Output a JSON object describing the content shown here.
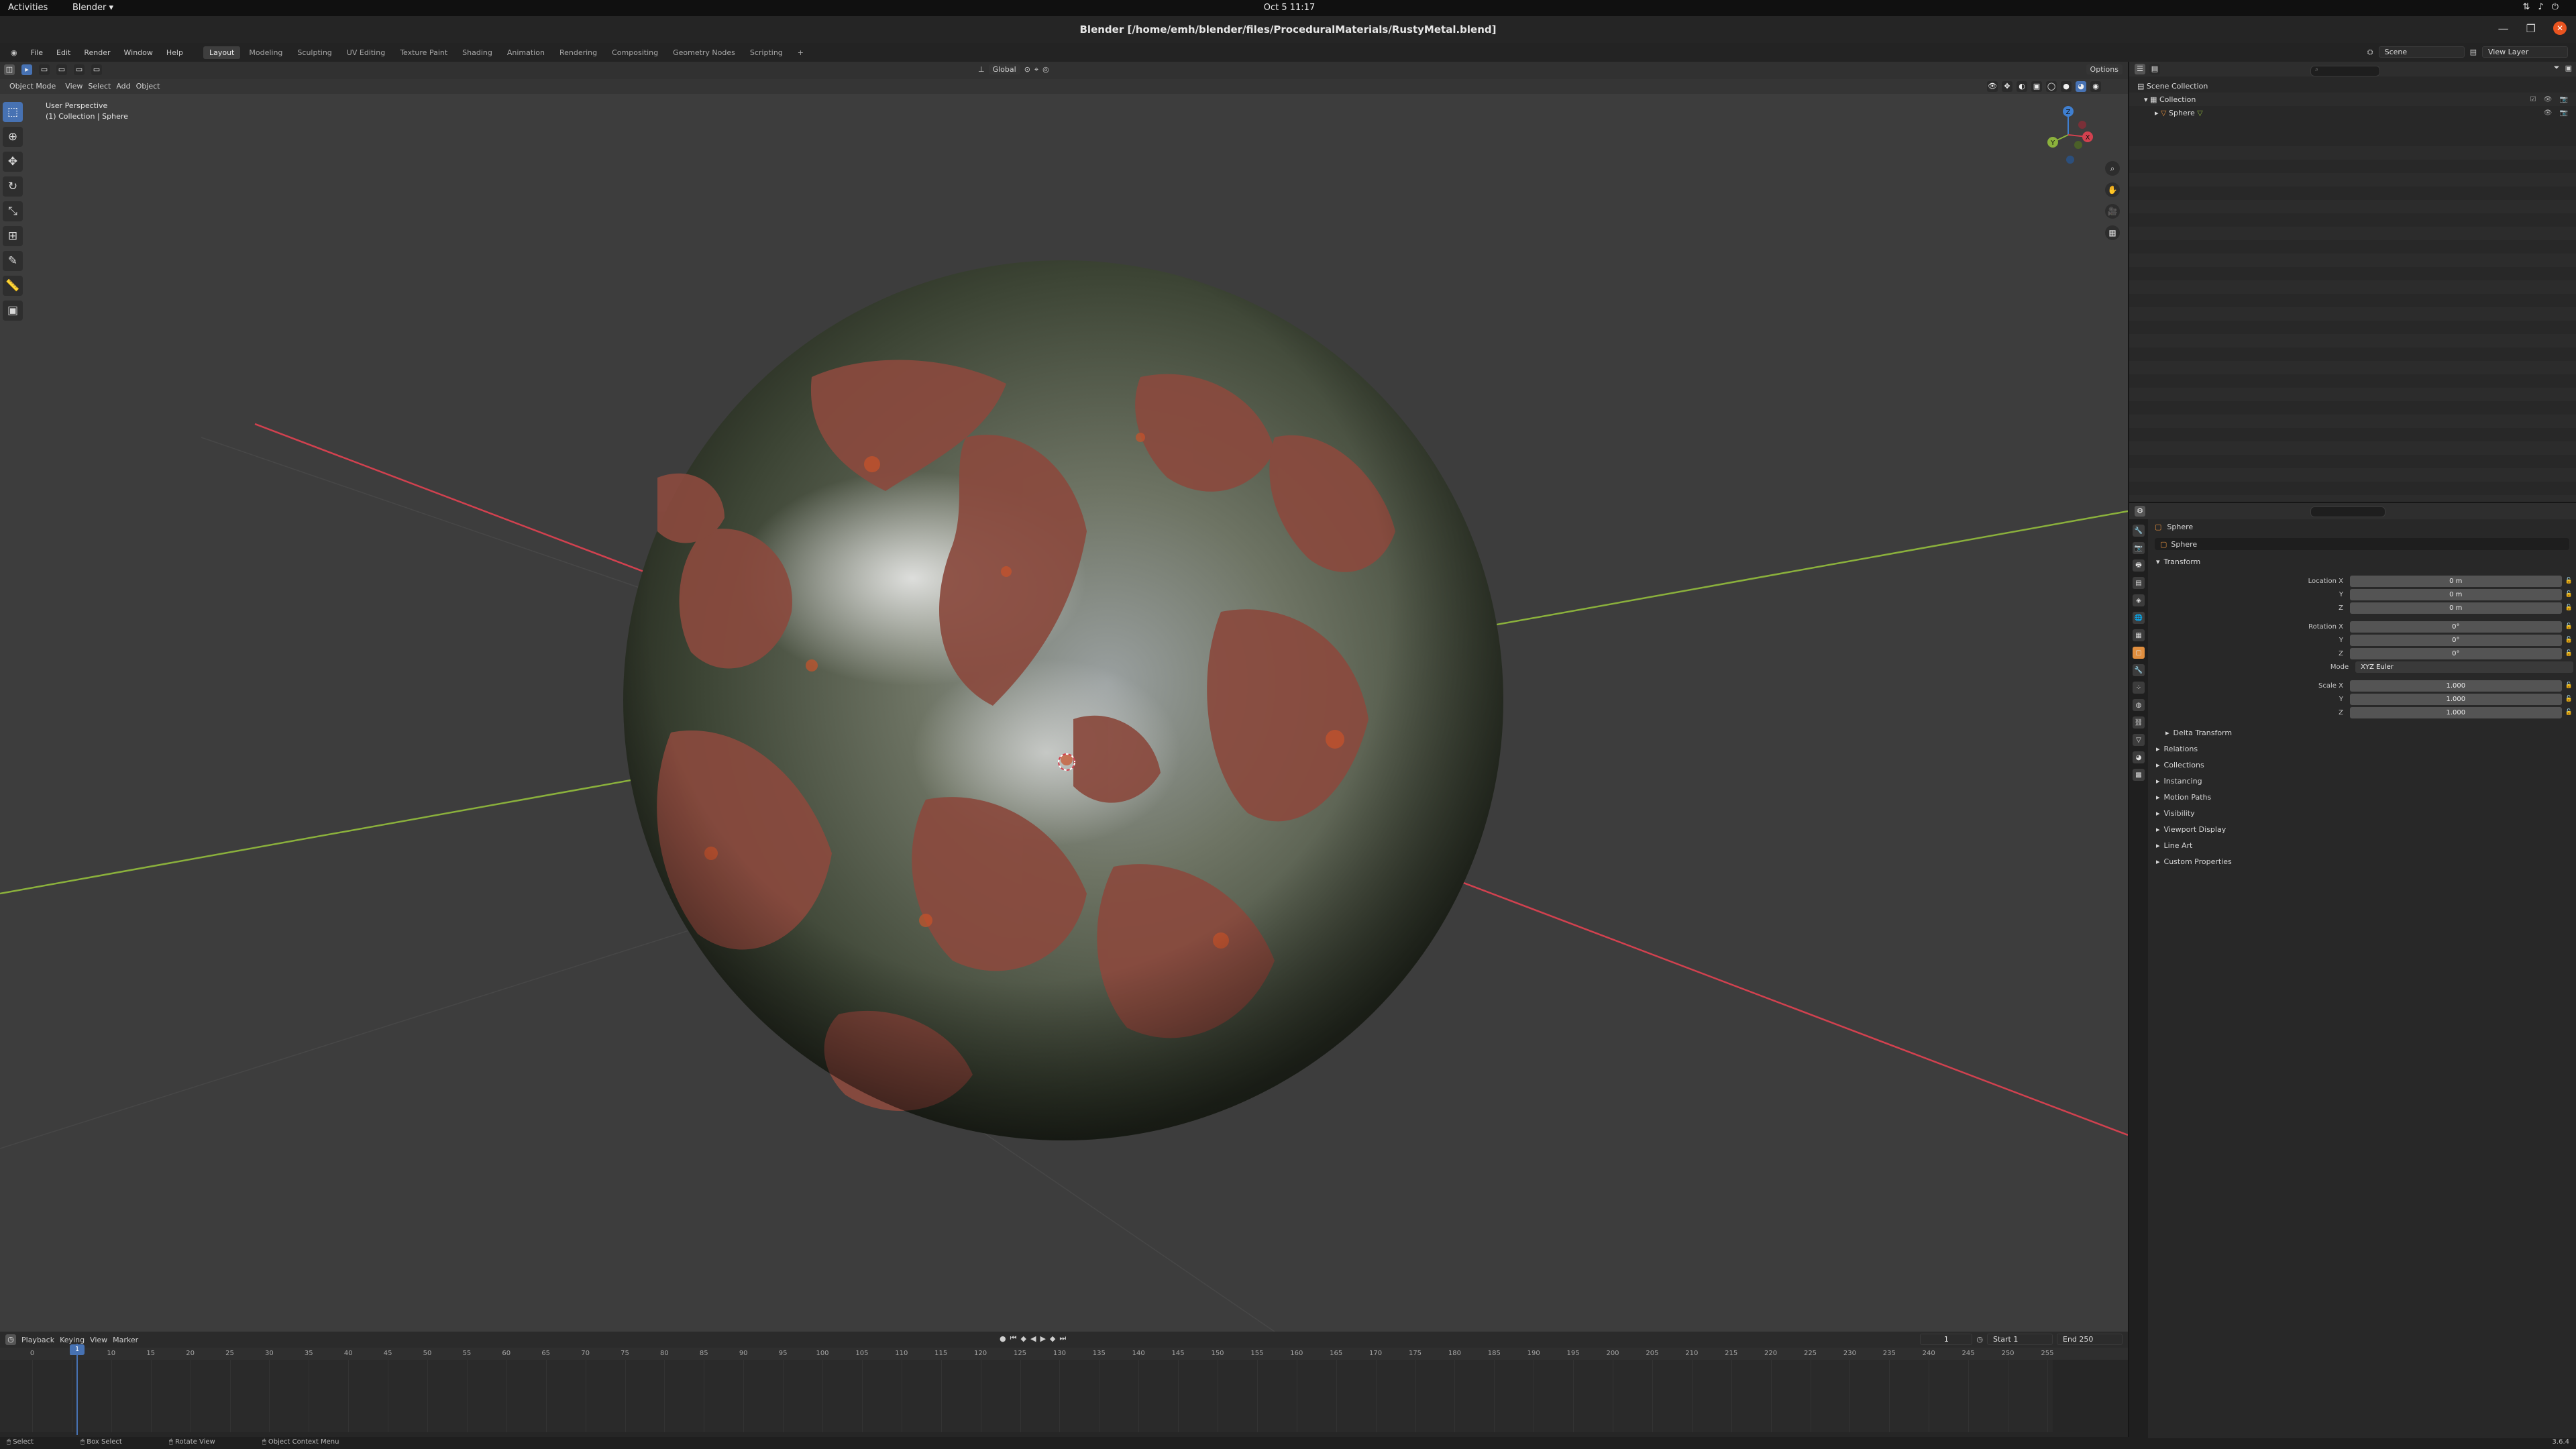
{
  "system_bar": {
    "activities": "Activities",
    "app": "Blender ▾",
    "clock": "Oct 5  11:17",
    "tray_icons": [
      "network-icon",
      "volume-icon",
      "power-icon"
    ]
  },
  "window": {
    "title": "Blender [/home/emh/blender/files/ProceduralMaterials/RustyMetal.blend]"
  },
  "menubar": {
    "menus": [
      "File",
      "Edit",
      "Render",
      "Window",
      "Help"
    ],
    "workspaces": [
      "Layout",
      "Modeling",
      "Sculpting",
      "UV Editing",
      "Texture Paint",
      "Shading",
      "Animation",
      "Rendering",
      "Compositing",
      "Geometry Nodes",
      "Scripting",
      "+"
    ],
    "active_workspace": "Layout",
    "scene": "Scene",
    "view_layer": "View Layer"
  },
  "viewport": {
    "mode": "Object Mode",
    "menus": [
      "View",
      "Select",
      "Add",
      "Object"
    ],
    "orientation": "Global",
    "options": "Options",
    "perspective": "User Perspective",
    "collection_info": "(1) Collection | Sphere",
    "tools": [
      "select-box-icon",
      "cursor-icon",
      "move-icon",
      "rotate-icon",
      "scale-icon",
      "transform-icon",
      "annotate-icon",
      "measure-icon",
      "add-cube-icon"
    ],
    "gizmo": {
      "x": "X",
      "y": "Y",
      "z": "Z"
    }
  },
  "timeline": {
    "menus": [
      "Playback",
      "Keying",
      "View",
      "Marker"
    ],
    "current_frame": "1",
    "start_label": "Start",
    "start": "1",
    "end_label": "End",
    "end": "250",
    "ruler": [
      "0",
      "5",
      "10",
      "15",
      "20",
      "25",
      "30",
      "35",
      "40",
      "45",
      "50",
      "55",
      "60",
      "65",
      "70",
      "75",
      "80",
      "85",
      "90",
      "95",
      "100",
      "105",
      "110",
      "115",
      "120",
      "125",
      "130",
      "135",
      "140",
      "145",
      "150",
      "155",
      "160",
      "165",
      "170",
      "175",
      "180",
      "185",
      "190",
      "195",
      "200",
      "205",
      "210",
      "215",
      "220",
      "225",
      "230",
      "235",
      "240",
      "245",
      "250",
      "255"
    ]
  },
  "statusbar": {
    "items": [
      "Select",
      "Box Select",
      "Rotate View",
      "Object Context Menu"
    ],
    "version": "3.6.4"
  },
  "outliner": {
    "rows": [
      {
        "label": "Scene Collection",
        "indent": 0
      },
      {
        "label": "Collection",
        "indent": 1
      },
      {
        "label": "Sphere",
        "indent": 2
      }
    ]
  },
  "properties": {
    "object_name": "Sphere",
    "datablock": "Sphere",
    "transform_label": "Transform",
    "location": {
      "label_x": "Location X",
      "label_y": "Y",
      "label_z": "Z",
      "x": "0 m",
      "y": "0 m",
      "z": "0 m"
    },
    "rotation": {
      "label_x": "Rotation X",
      "label_y": "Y",
      "label_z": "Z",
      "x": "0°",
      "y": "0°",
      "z": "0°"
    },
    "mode": {
      "label": "Mode",
      "value": "XYZ Euler"
    },
    "scale": {
      "label_x": "Scale X",
      "label_y": "Y",
      "label_z": "Z",
      "x": "1.000",
      "y": "1.000",
      "z": "1.000"
    },
    "panels": [
      "Delta Transform",
      "Relations",
      "Collections",
      "Instancing",
      "Motion Paths",
      "Visibility",
      "Viewport Display",
      "Line Art",
      "Custom Properties"
    ]
  },
  "colors": {
    "accent": "#4772b3",
    "object_tab": "#e08e3e",
    "x_axis": "#d2414f",
    "y_axis": "#8bb13c",
    "z_axis": "#3f7fd0"
  }
}
